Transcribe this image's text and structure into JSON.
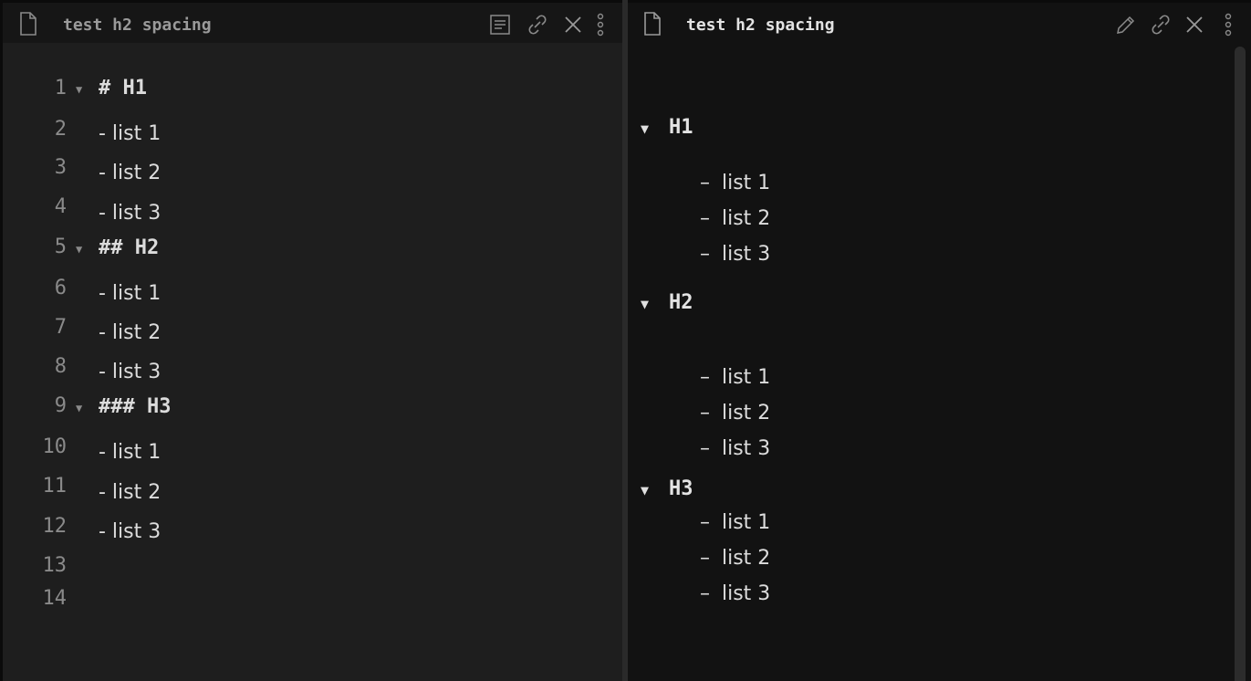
{
  "left_pane": {
    "title": "test h2 spacing",
    "actions": [
      "reading-view-icon",
      "link-icon",
      "close-icon",
      "more-options-icon"
    ],
    "lines": [
      {
        "num": "1",
        "text": "# H1",
        "heading": true
      },
      {
        "num": "2",
        "text": "- list 1"
      },
      {
        "num": "3",
        "text": "- list 2"
      },
      {
        "num": "4",
        "text": "- list 3"
      },
      {
        "num": "5",
        "text": "## H2",
        "heading": true
      },
      {
        "num": "6",
        "text": "- list 1"
      },
      {
        "num": "7",
        "text": "- list 2"
      },
      {
        "num": "8",
        "text": "- list 3"
      },
      {
        "num": "9",
        "text": "### H3",
        "heading": true
      },
      {
        "num": "10",
        "text": "- list 1"
      },
      {
        "num": "11",
        "text": "- list 2"
      },
      {
        "num": "12",
        "text": "- list 3"
      },
      {
        "num": "13",
        "text": ""
      },
      {
        "num": "14",
        "text": ""
      }
    ]
  },
  "right_pane": {
    "title": "test h2 spacing",
    "actions": [
      "edit-pencil-icon",
      "link-icon",
      "close-icon",
      "more-options-icon"
    ],
    "sections": [
      {
        "heading": "H1",
        "items": [
          "list 1",
          "list 2",
          "list 3"
        ]
      },
      {
        "heading": "H2",
        "items": [
          "list 1",
          "list 2",
          "list 3"
        ]
      },
      {
        "heading": "H3",
        "items": [
          "list 1",
          "list 2",
          "list 3"
        ]
      }
    ],
    "dash": "–",
    "fold_glyph": "▼"
  },
  "colors": {
    "left_bg": "#1e1e1e",
    "right_bg": "#121212",
    "text": "#dcdcdc",
    "muted": "#8a8a8a"
  }
}
